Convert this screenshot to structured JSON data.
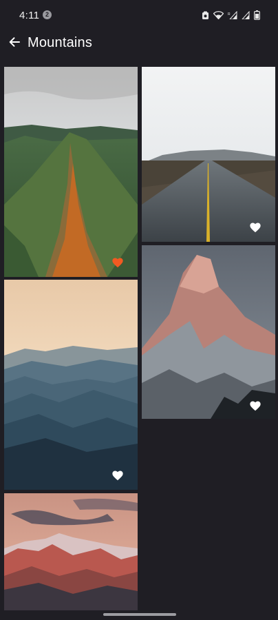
{
  "status_bar": {
    "time": "4:11",
    "notification_count": "2",
    "icons": [
      "screenshot-icon",
      "wifi-icon",
      "signal-icon",
      "signal-icon",
      "battery-icon"
    ]
  },
  "app_bar": {
    "back_icon": "arrow-left-icon",
    "title": "Mountains"
  },
  "photos": [
    {
      "subject": "green mountain ridge with orange path",
      "favorited": true,
      "heart_color": "#f15a22"
    },
    {
      "subject": "road leading to distant mountains",
      "favorited": false,
      "heart_color": "#ffffff"
    },
    {
      "subject": "snow-capped peak at sunrise",
      "favorited": false,
      "heart_color": "#ffffff"
    },
    {
      "subject": "misty layered mountain ranges",
      "favorited": false,
      "heart_color": "#ffffff"
    },
    {
      "subject": "pink alpine range under clouds",
      "favorited": false,
      "heart_color": "#ffffff"
    }
  ],
  "colors": {
    "background": "#1f1e24",
    "favorite": "#f15a22"
  }
}
